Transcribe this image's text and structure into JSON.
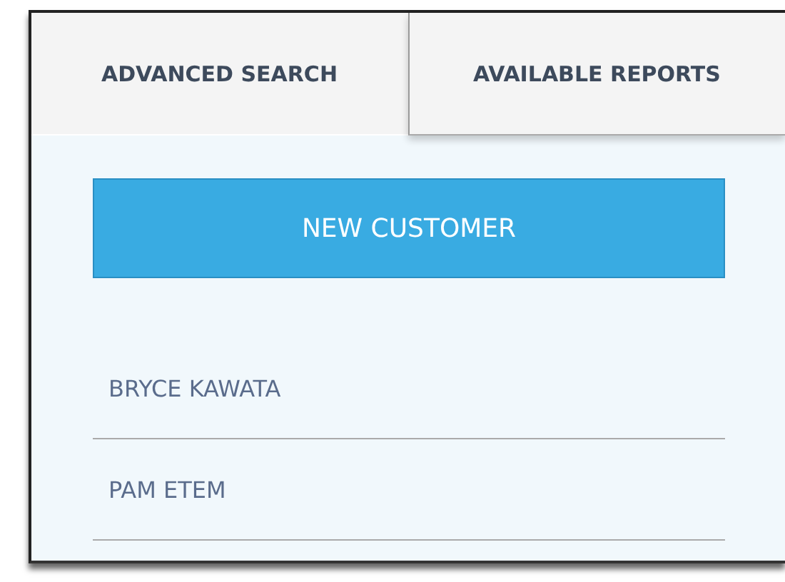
{
  "tabs": [
    {
      "label": "ADVANCED SEARCH",
      "selected": true
    },
    {
      "label": "AVAILABLE REPORTS",
      "selected": false
    }
  ],
  "new_customer_button": "NEW CUSTOMER",
  "customers": [
    {
      "name": "BRYCE KAWATA"
    },
    {
      "name": "PAM ETEM"
    }
  ]
}
